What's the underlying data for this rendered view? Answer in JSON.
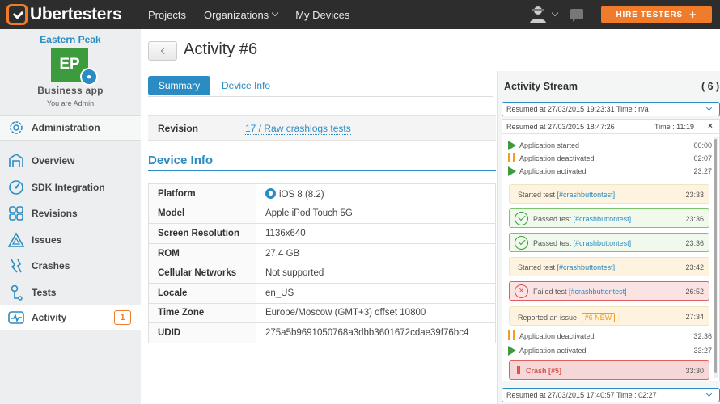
{
  "header": {
    "logo_text": "Ubertesters",
    "nav": [
      "Projects",
      "Organizations",
      "My Devices"
    ],
    "hire_label": "HIRE TESTERS",
    "hire_plus": "+"
  },
  "sidebar": {
    "org_name": "Eastern Peak",
    "app_initials": "EP",
    "app_name": "Business app",
    "role": "You are Admin",
    "admin_label": "Administration",
    "items": [
      {
        "label": "Overview"
      },
      {
        "label": "SDK Integration"
      },
      {
        "label": "Revisions"
      },
      {
        "label": "Issues"
      },
      {
        "label": "Crashes"
      },
      {
        "label": "Tests"
      },
      {
        "label": "Activity",
        "badge": "1"
      }
    ]
  },
  "main": {
    "title": "Activity #6",
    "tabs": [
      "Summary",
      "Device Info"
    ],
    "revision_label": "Revision",
    "revision_value": "17 / Raw crashlogs tests",
    "section_title": "Device Info",
    "device_info": [
      {
        "k": "Platform",
        "v": "iOS 8 (8.2)"
      },
      {
        "k": "Model",
        "v": "Apple iPod Touch 5G"
      },
      {
        "k": "Screen Resolution",
        "v": "1136x640"
      },
      {
        "k": "ROM",
        "v": "27.4 GB"
      },
      {
        "k": "Cellular Networks",
        "v": "Not supported"
      },
      {
        "k": "Locale",
        "v": "en_US"
      },
      {
        "k": "Time Zone",
        "v": "Europe/Moscow (GMT+3) offset 10800"
      },
      {
        "k": "UDID",
        "v": "275a5b9691050768a3dbb3601672cdae39f76bc4"
      }
    ]
  },
  "stream": {
    "title": "Activity Stream",
    "count": "( 6 )",
    "top_bar": "Resumed at 27/03/2015 19:23:31 Time : n/a",
    "session_label": "Resumed at 27/03/2015 18:47:26",
    "session_time": "Time : 11:19",
    "session_close": "×",
    "events": [
      {
        "kind": "play",
        "text": "Application started",
        "time": "00:00"
      },
      {
        "kind": "pause",
        "text": "Application deactivated",
        "time": "02:07"
      },
      {
        "kind": "play",
        "text": "Application activated",
        "time": "23:27"
      }
    ],
    "cards": [
      {
        "kind": "start",
        "prefix": "Started  test",
        "link": "[#crashbuttontest]",
        "time": "23:33"
      },
      {
        "kind": "pass",
        "prefix": "Passed  test",
        "link": "[#crashbuttontest]",
        "time": "23:36"
      },
      {
        "kind": "pass",
        "prefix": "Passed  test",
        "link": "[#crashbuttontest]",
        "time": "23:36"
      },
      {
        "kind": "start",
        "prefix": "Started  test",
        "link": "[#crashbuttontest]",
        "time": "23:42"
      },
      {
        "kind": "fail",
        "prefix": "Failed  test",
        "link": "[#crashbuttontest]",
        "time": "26:52"
      },
      {
        "kind": "issue",
        "prefix": "Reported an issue",
        "badge": "#6 NEW",
        "time": "27:34"
      }
    ],
    "events2": [
      {
        "kind": "pause",
        "text": "Application deactivated",
        "time": "32:36"
      },
      {
        "kind": "play",
        "text": "Application activated",
        "time": "33:27"
      }
    ],
    "crash": {
      "text": "Crash [#5]",
      "time": "33:30"
    },
    "bottom_bar": "Resumed at 27/03/2015 17:40:57 Time : 02:27"
  },
  "colors": {
    "accent": "#2b8cc4",
    "brand_orange": "#f07c2b",
    "topbar": "#2d2d2d"
  }
}
